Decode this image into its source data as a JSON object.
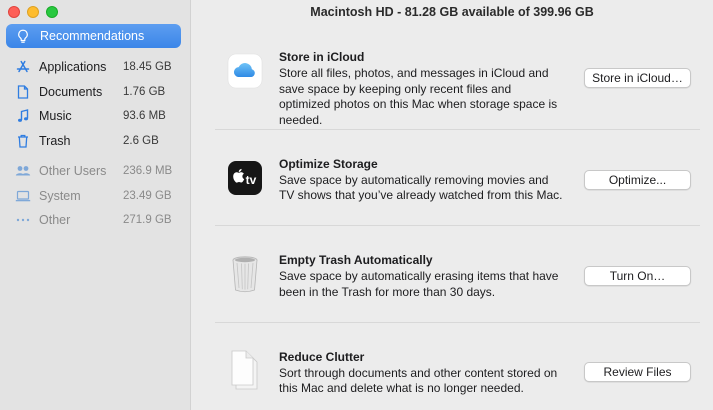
{
  "window": {
    "title": "Macintosh HD - 81.28 GB available of 399.96 GB"
  },
  "sidebar": {
    "selected": {
      "label": "Recommendations",
      "icon": "lightbulb-icon"
    },
    "items": [
      {
        "label": "Applications",
        "size": "18.45 GB",
        "icon": "app-store-icon"
      },
      {
        "label": "Documents",
        "size": "1.76 GB",
        "icon": "document-icon"
      },
      {
        "label": "Music",
        "size": "93.6 MB",
        "icon": "music-note-icon"
      },
      {
        "label": "Trash",
        "size": "2.6 GB",
        "icon": "trash-icon"
      }
    ],
    "other_items": [
      {
        "label": "Other Users",
        "size": "236.9 MB",
        "icon": "users-icon"
      },
      {
        "label": "System",
        "size": "23.49 GB",
        "icon": "laptop-icon"
      },
      {
        "label": "Other",
        "size": "271.9 GB",
        "icon": "ellipsis-icon"
      }
    ]
  },
  "recommendations": [
    {
      "title": "Store in iCloud",
      "description": "Store all files, photos, and messages in iCloud and save space by keeping only recent files and optimized photos on this Mac when storage space is needed.",
      "button": "Store in iCloud…",
      "icon": "icloud-icon"
    },
    {
      "title": "Optimize Storage",
      "description": "Save space by automatically removing movies and TV shows that you’ve already watched from this Mac.",
      "button": "Optimize...",
      "icon": "apple-tv-icon",
      "icon_text": "tv"
    },
    {
      "title": "Empty Trash Automatically",
      "description": "Save space by automatically erasing items that have been in the Trash for more than 30 days.",
      "button": "Turn On…",
      "icon": "trash-bin-icon"
    },
    {
      "title": "Reduce Clutter",
      "description": "Sort through documents and other content stored on this Mac and delete what is no longer needed.",
      "button": "Review Files",
      "icon": "documents-stack-icon"
    }
  ],
  "colors": {
    "accent": "#3b86e8",
    "sidebar_bg": "#e3e3e3",
    "main_bg": "#ececec",
    "icon_blue": "#2f7de1"
  }
}
